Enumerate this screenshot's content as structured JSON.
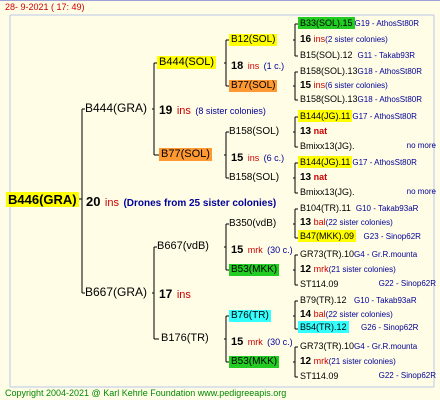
{
  "header": {
    "timestamp": "28- 9-2021 ( 17: 49)"
  },
  "footer": {
    "copyright": "Copyright 2004-2021 @ Karl Kehrle Foundation   www.pedigreeapis.org"
  },
  "root": {
    "name": "B446(GRA)",
    "count": "20",
    "ins": "ins",
    "note": "(Drones from 25 sister colonies)"
  },
  "gen1": [
    {
      "name": "B444(GRA)",
      "count": "19",
      "ins": "ins",
      "note": "(8 sister colonies)"
    },
    {
      "name": "B667(GRA)",
      "count": "17",
      "ins": "ins"
    }
  ],
  "gen2": [
    {
      "name": "B444(SOL)",
      "count": "18",
      "ins": "ins",
      "note": "(1 c.)"
    },
    {
      "name": "B77(SOL)",
      "count": "15",
      "ins": "ins",
      "note": "(6 c.)"
    },
    {
      "name": "B667(vdB)",
      "count": "15",
      "ins": "mrk",
      "note": "(30 c.)"
    },
    {
      "name": "B176(TR)",
      "count": "15",
      "ins": "mrk",
      "note": "(30 c.)"
    }
  ],
  "gen3": [
    {
      "name": "B12(SOL)",
      "count": "16",
      "ins": "ins",
      "note": "(1 c.)"
    },
    {
      "name": "B77(SOL)",
      "count": "15",
      "ins": "ins",
      "note": "(6 c.)"
    },
    {
      "name": "B158(SOL)"
    },
    {
      "name": "B158(SOL)"
    },
    {
      "name": "B350(vdB)"
    },
    {
      "name": "B53(MKK)"
    },
    {
      "name": "B76(TR)"
    },
    {
      "name": "B53(MKK)"
    }
  ],
  "gen4": [
    {
      "name": "B33(SOL).15",
      "right": "G19 - AthosSt80R"
    },
    {
      "count": "16",
      "ins": "ins",
      "note": "(2 sister colonies)"
    },
    {
      "name": "B15(SOL).12",
      "right": "G11 - Takab93R"
    },
    {
      "name": "B158(SOL).13",
      "right": "G18 - AthosSt80R"
    },
    {
      "count": "15",
      "ins": "ins",
      "note": "(6 sister colonies)"
    },
    {
      "name": "B158(SOL).13",
      "right": "G18 - AthosSt80R"
    },
    {
      "name": "B144(JG).11",
      "right": "G17 - AthosSt80R"
    },
    {
      "count": "13",
      "ins": "nat"
    },
    {
      "name": "Bmixx13(JG).",
      "right": "no more"
    },
    {
      "name": "B144(JG).11",
      "right": "G17 - AthosSt80R"
    },
    {
      "count": "13",
      "ins": "nat"
    },
    {
      "name": "Bmixx13(JG).",
      "right": "no more"
    },
    {
      "name": "B104(TR).11",
      "right": "G10 - Takab93aR"
    },
    {
      "count": "13",
      "ins": "bal",
      "note": "(22 sister colonies)"
    },
    {
      "name": "B47(MKK).09",
      "right": "G23 - Sinop62R"
    },
    {
      "name": "GR73(TR).10",
      "right": "G4 - Gr.R.mounta"
    },
    {
      "count": "12",
      "ins": "mrk",
      "note": "(21 sister colonies)"
    },
    {
      "name": "ST114.09",
      "right": "G22 - Sinop62R"
    },
    {
      "name": "B79(TR).12",
      "right": "G10 - Takab93aR"
    },
    {
      "count": "14",
      "ins": "bal",
      "note": "(22 sister colonies)"
    },
    {
      "name": "B54(TR).12",
      "right": "G26 - Sinop62R"
    },
    {
      "name": "GR73(TR).10",
      "right": "G4 - Gr.R.mounta"
    },
    {
      "count": "12",
      "ins": "mrk",
      "note": "(21 sister colonies)"
    },
    {
      "name": "ST114.09",
      "right": "G22 - Sinop62R"
    }
  ]
}
